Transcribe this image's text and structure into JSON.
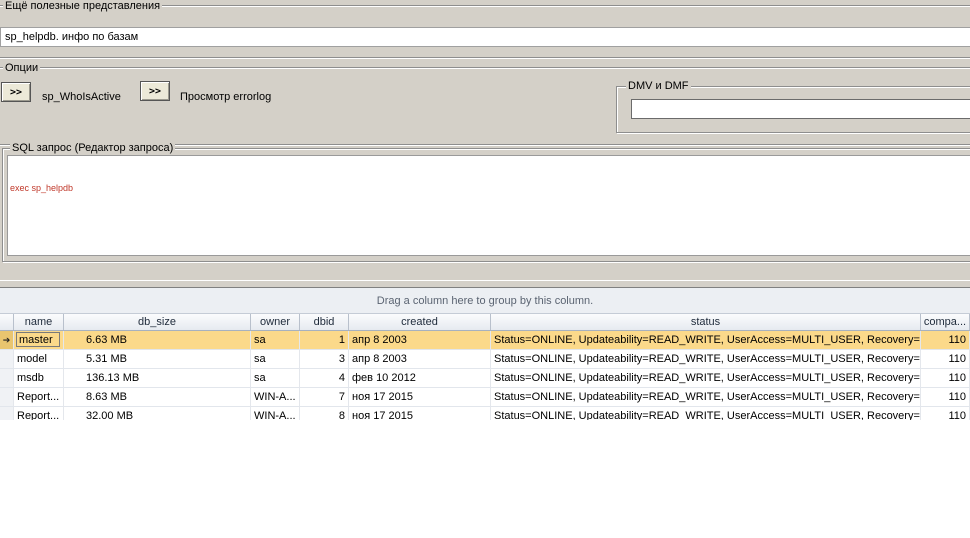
{
  "extra_views": {
    "legend": "Ещё  полезные представления",
    "selected_value": "sp_helpdb. инфо по базам"
  },
  "options": {
    "legend": "Опции",
    "btn1_label": ">>",
    "btn1_text": "sp_WhoIsActive",
    "btn2_label": ">>",
    "btn2_text": "Просмотр errorlog",
    "dmv_legend": "DMV и DMF",
    "dmv_value": ""
  },
  "sql": {
    "legend": "SQL запрос (Редактор запроса)",
    "query": "exec sp_helpdb",
    "query_color": "#c0392b"
  },
  "grid": {
    "group_panel_text": "Drag a column here to group by this column.",
    "columns": [
      "name",
      "db_size",
      "owner",
      "dbid",
      "created",
      "status",
      "compa..."
    ],
    "rows": [
      {
        "indicator": "➔",
        "name": "master",
        "db_size": "6.63 MB",
        "owner": "sa",
        "dbid": "1",
        "created": "апр  8 2003",
        "status": "Status=ONLINE, Updateability=READ_WRITE, UserAccess=MULTI_USER, Recovery=...",
        "compat": "110",
        "selected": true
      },
      {
        "indicator": "",
        "name": "model",
        "db_size": "5.31 MB",
        "owner": "sa",
        "dbid": "3",
        "created": "апр  8 2003",
        "status": "Status=ONLINE, Updateability=READ_WRITE, UserAccess=MULTI_USER, Recovery=...",
        "compat": "110",
        "selected": false
      },
      {
        "indicator": "",
        "name": "msdb",
        "db_size": "136.13 MB",
        "owner": "sa",
        "dbid": "4",
        "created": "фев 10 2012",
        "status": "Status=ONLINE, Updateability=READ_WRITE, UserAccess=MULTI_USER, Recovery=...",
        "compat": "110",
        "selected": false
      },
      {
        "indicator": "",
        "name": "Report...",
        "db_size": "8.63 MB",
        "owner": "WIN-A...",
        "dbid": "7",
        "created": "ноя 17 2015",
        "status": "Status=ONLINE, Updateability=READ_WRITE, UserAccess=MULTI_USER, Recovery=...",
        "compat": "110",
        "selected": false
      },
      {
        "indicator": "",
        "name": "Report...",
        "db_size": "32.00 MB",
        "owner": "WIN-A...",
        "dbid": "8",
        "created": "ноя 17 2015",
        "status": "Status=ONLINE, Updateability=READ_WRITE, UserAccess=MULTI_USER, Recovery=...",
        "compat": "110",
        "selected": false
      }
    ]
  }
}
